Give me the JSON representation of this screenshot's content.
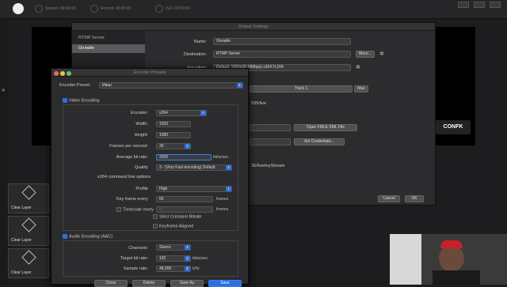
{
  "topbar": {
    "stream": "Stream: 00:00:00",
    "record": "Record: 00:00:00",
    "iso": "ISO: 00:00:00"
  },
  "layers": [
    "Clear Layer",
    "Clear Layer",
    "Clear Layer"
  ],
  "output": {
    "title": "Output Settings",
    "sidebar_header": "RTMP Server",
    "sidebar_item": "Онлайн",
    "name_label": "Name:",
    "name_value": "Онлайн",
    "destination_label": "Destination:",
    "destination_value": "RTMP Server",
    "more": "More...",
    "encoding_label": "Encoding:",
    "encoding_value": "Default: 1080p30 (4Mbps) x264 H.264",
    "track": "Track 1",
    "map": "Map",
    "url_frag": "935/live",
    "fmle": "Open FMLE XML File",
    "set_cred": "Set Credentials...",
    "url_frag2": "35/live/myStream",
    "cancel": "Cancel",
    "ok": "OK"
  },
  "encoder": {
    "title": "Encoder Presets",
    "preset_label": "Encoder Preset:",
    "preset_value": "Иван",
    "video_label": "Video Encoding",
    "encoder_label": "Encoder:",
    "encoder_value": "x264",
    "width_label": "Width:",
    "width_value": "1920",
    "height_label": "Height:",
    "height_value": "1080",
    "fps_label": "Frames per second:",
    "fps_value": "30",
    "bitrate_label": "Average bit rate:",
    "bitrate_value": "3000",
    "bitrate_unit": "kbits/sec",
    "quality_label": "Quality",
    "quality_value": "3 - (Very Fast encoding) Default",
    "cmd_label": "x264 command line options",
    "profile_label": "Profile",
    "profile_value": "High",
    "keyframe_label": "Key frame every",
    "keyframe_value": "60",
    "frames1": "frames",
    "timecode_label": "Timecode every",
    "timecode_value": "0",
    "frames2": "frames",
    "strict_label": "Strict Constant Bitrate",
    "keyframe_aligned": "Keyframe Aligned",
    "audio_label": "Audio Encoding (AAC)",
    "channels_label": "Channels:",
    "channels_value": "Stereo",
    "target_label": "Target bit rate:",
    "target_value": "192",
    "target_unit": "kbits/sec",
    "sample_label": "Sample rate:",
    "sample_value": "48,000",
    "sample_unit": "kHz",
    "close": "Close",
    "delete": "Delete",
    "saveas": "Save As",
    "save": "Save"
  }
}
